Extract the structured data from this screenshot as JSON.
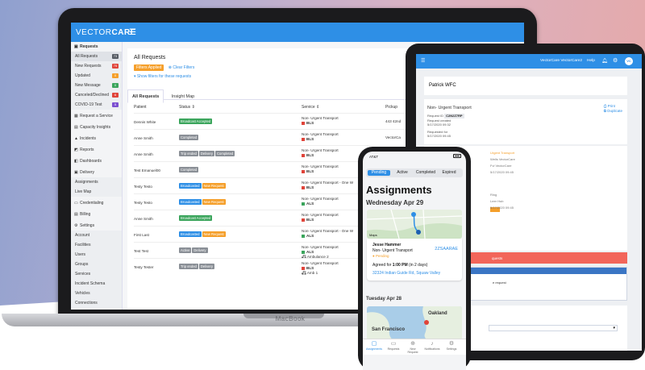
{
  "laptop": {
    "brand_label": "MacBook",
    "logo": {
      "part1": "VECTOR",
      "part2": "CARE"
    },
    "menu_icon": "hamburger-collapse-icon",
    "sidebar": {
      "requests_header": "Requests",
      "request_items": [
        {
          "label": "All Requests",
          "count": "73",
          "color": "#555b63"
        },
        {
          "label": "New Requests",
          "count": "75",
          "color": "#e0443a"
        },
        {
          "label": "Updated",
          "count": "0",
          "color": "#f59f2a"
        },
        {
          "label": "New Message",
          "count": "0",
          "color": "#3ba55c"
        },
        {
          "label": "Canceled/Declined",
          "count": "6",
          "color": "#e0443a"
        },
        {
          "label": "COVID-19 Test",
          "count": "5",
          "color": "#7b4fd0"
        }
      ],
      "nav": [
        {
          "label": "Request a Service",
          "icon": "calendar-plus-icon"
        },
        {
          "label": "Capacity Insights",
          "icon": "grid-icon"
        },
        {
          "label": "Incidents",
          "icon": "warning-icon"
        },
        {
          "label": "Reports",
          "icon": "chart-icon"
        },
        {
          "label": "Dashboards",
          "icon": "dashboard-icon"
        },
        {
          "label": "Delivery",
          "icon": "calendar-icon"
        }
      ],
      "delivery_items": [
        "Assignments",
        "Live Map"
      ],
      "nav2": [
        {
          "label": "Credentialing",
          "icon": "id-card-icon"
        },
        {
          "label": "Billing",
          "icon": "receipt-icon"
        },
        {
          "label": "Settings",
          "icon": "gear-icon"
        }
      ],
      "settings_items": [
        "Account",
        "Facilities",
        "Users",
        "Groups",
        "Services",
        "Incident Schema",
        "Vehicles",
        "Connections"
      ]
    },
    "page": {
      "title": "All Requests",
      "filters_badge": "Filters Applied",
      "clear_filters": "Clear Filters",
      "show_filters": "Show filters for these requests",
      "tabs": [
        "All Requests",
        "Insight Map"
      ]
    },
    "table": {
      "headers": [
        "Patient",
        "Status",
        "Service",
        "Pickup"
      ],
      "rows": [
        {
          "patient": "Dennis White",
          "tags": [
            {
              "t": "Broadcast Accepted",
              "c": "green"
            }
          ],
          "service": "Non- Urgent Transport",
          "level": "BLS",
          "level_color": "#e0443a",
          "extra": "",
          "pickup": "443 42nd"
        },
        {
          "patient": "Anne Smith",
          "tags": [
            {
              "t": "Completed",
              "c": "gray"
            }
          ],
          "service": "Non- Urgent Transport",
          "level": "BLS",
          "level_color": "#e0443a",
          "extra": "",
          "pickup": "VectorCa"
        },
        {
          "patient": "Anne Smith",
          "tags": [
            {
              "t": "Trip ended",
              "c": "gray"
            },
            {
              "t": "Delivery",
              "c": "gray"
            },
            {
              "t": "Completed",
              "c": "gray"
            }
          ],
          "service": "Non- Urgent Transport",
          "level": "BLS",
          "level_color": "#e0443a",
          "extra": "",
          "pickup": ""
        },
        {
          "patient": "Test Emanuel00",
          "tags": [
            {
              "t": "Completed",
              "c": "gray"
            }
          ],
          "service": "Non- Urgent Transport",
          "level": "BLS",
          "level_color": "#e0443a",
          "extra": "",
          "pickup": ""
        },
        {
          "patient": "Testy Testo",
          "tags": [
            {
              "t": "Broadcasted",
              "c": "blue"
            },
            {
              "t": "New Request",
              "c": "orange"
            }
          ],
          "service": "Non- Urgent Transport - One W",
          "level": "BLS",
          "level_color": "#e0443a",
          "extra": "",
          "pickup": ""
        },
        {
          "patient": "Testy Testo",
          "tags": [
            {
              "t": "Broadcasted",
              "c": "blue"
            },
            {
              "t": "New Request",
              "c": "orange"
            }
          ],
          "service": "Non- Urgent Transport",
          "level": "ALS",
          "level_color": "#3ba55c",
          "extra": "",
          "pickup": ""
        },
        {
          "patient": "Anne Smith",
          "tags": [
            {
              "t": "Broadcast Accepted",
              "c": "green"
            }
          ],
          "service": "Non- Urgent Transport",
          "level": "BLS",
          "level_color": "#e0443a",
          "extra": "",
          "pickup": ""
        },
        {
          "patient": "First Last",
          "tags": [
            {
              "t": "Broadcasted",
              "c": "blue"
            },
            {
              "t": "New Request",
              "c": "orange"
            }
          ],
          "service": "Non- Urgent Transport - One W",
          "level": "ALS",
          "level_color": "#3ba55c",
          "extra": "",
          "pickup": ""
        },
        {
          "patient": "Test Test",
          "tags": [
            {
              "t": "Active",
              "c": "gray"
            },
            {
              "t": "Delivery",
              "c": "gray"
            }
          ],
          "service": "Non- Urgent Transport",
          "level": "ALS",
          "level_color": "#3ba55c",
          "extra": "Ambulance 2",
          "pickup": ""
        },
        {
          "patient": "Testy Tester",
          "tags": [
            {
              "t": "Trip ended",
              "c": "gray"
            },
            {
              "t": "Delivery",
              "c": "gray"
            }
          ],
          "service": "Non- Urgent Transport",
          "level": "BLS",
          "level_color": "#e0443a",
          "extra": "Amb 1",
          "pickup": ""
        }
      ]
    }
  },
  "tablet": {
    "app_name": "VectorCare VectorCare2",
    "help": "Help",
    "avatar": "VC",
    "patient": "Patrick WFC",
    "service": "Non- Urgent Transport",
    "print": "Print",
    "duplicate": "Duplicate",
    "request_id_label": "Request ID",
    "request_id": "C2N2Z7RP",
    "created_label": "Request created",
    "created": "5/17/2020 09:32",
    "requested_label": "Requested for",
    "requested": "5/17/2020 09:45",
    "details": [
      "Urgent Transport",
      "Wells VectorCare",
      "Fvl VectorCare",
      "5/17/2020 09:45",
      "",
      "Ring",
      "Leer Hub",
      "5/17/2020 09:45"
    ],
    "alert": "quests",
    "panel_text": "e request",
    "select_arrow": "chevron-down-icon"
  },
  "phone": {
    "carrier": "AT&T",
    "time": "",
    "segments": [
      "Pending",
      "Active",
      "Completed",
      "Expired"
    ],
    "title": "Assignments",
    "date1": "Wednesday Apr 29",
    "maps_label": "Maps",
    "card": {
      "name": "Jesse Hammer",
      "id": "2ZSAARAE",
      "type": "Non- Urgent Transport",
      "status": "Pending",
      "agreed_prefix": "Agreed for",
      "agreed_time": "1:00 PM",
      "agreed_suffix": "(in 2 days)",
      "address": "32324 Indian Guide Rd, Squaw Valley"
    },
    "date2": "Tuesday Apr 28",
    "map2_labels": [
      "San Francisco",
      "Oakland"
    ],
    "tabbar": [
      {
        "label": "Assignments",
        "icon": "assignment-icon"
      },
      {
        "label": "Requests",
        "icon": "inbox-icon"
      },
      {
        "label": "New Request",
        "icon": "plus-circle-icon"
      },
      {
        "label": "Notifications",
        "icon": "bell-icon"
      },
      {
        "label": "Settings",
        "icon": "gear-icon"
      }
    ]
  }
}
